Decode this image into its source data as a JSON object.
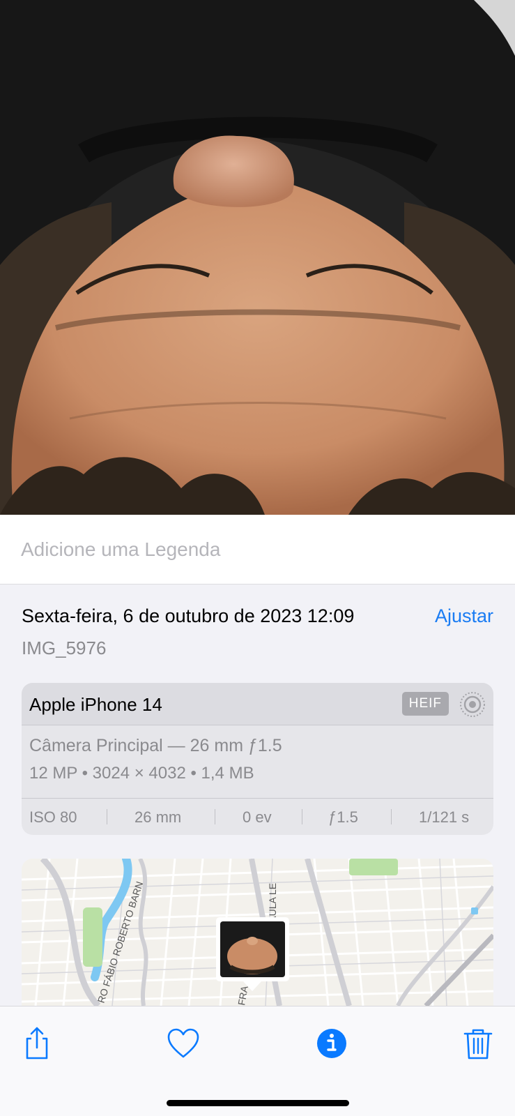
{
  "caption": {
    "placeholder": "Adicione uma Legenda"
  },
  "info": {
    "date": "Sexta-feira, 6 de outubro de 2023 12:09",
    "adjust_label": "Ajustar",
    "filename": "IMG_5976"
  },
  "camera": {
    "device": "Apple iPhone 14",
    "format": "HEIF",
    "live_icon": "live-photo-icon",
    "lens": "Câmera Principal — 26 mm ƒ1.5",
    "specs": "12 MP  •  3024 × 4032  •  1,4 MB",
    "exif": {
      "iso": "ISO 80",
      "focal": "26 mm",
      "ev": "0 ev",
      "aperture": "ƒ1.5",
      "shutter": "1/121 s"
    }
  },
  "map": {
    "street_1": "RO FÁBIO ROBERTO BARN",
    "street_2": "PAULA LE",
    "street_3": "FRA"
  },
  "toolbar": {
    "share_icon": "share-icon",
    "favorite_icon": "heart-icon",
    "info_icon": "info-icon",
    "delete_icon": "trash-icon"
  },
  "colors": {
    "accent": "#1a7cf3",
    "info_active": "#0a7aff"
  }
}
